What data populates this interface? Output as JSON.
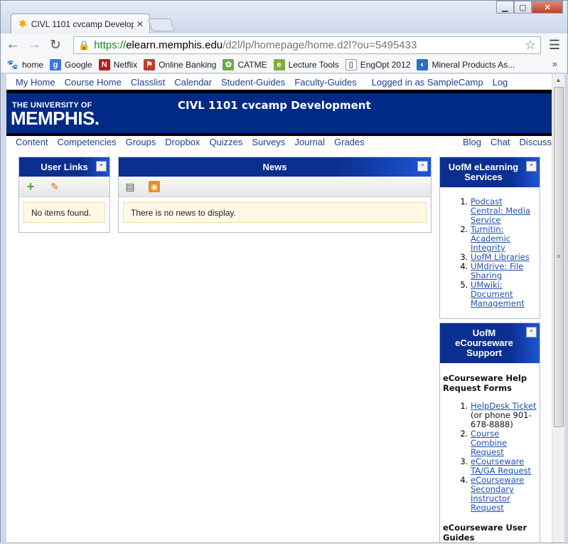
{
  "browser": {
    "tab_title": "CIVL 1101 cvcamp Develop",
    "url_scheme": "https://",
    "url_host": "elearn.memphis.edu",
    "url_path": "/d2l/lp/homepage/home.d2l?ou=5495433",
    "bookmarks": [
      {
        "label": "home",
        "icon": "paw-icon",
        "color": "#1c3f94"
      },
      {
        "label": "Google",
        "icon": "google-icon",
        "color": "#3b76d9"
      },
      {
        "label": "Netflix",
        "icon": "netflix-icon",
        "color": "#b51d1d"
      },
      {
        "label": "Online Banking",
        "icon": "bank-icon",
        "color": "#c23a2b"
      },
      {
        "label": "CATME",
        "icon": "catme-icon",
        "color": "#6aa84f"
      },
      {
        "label": "Lecture Tools",
        "icon": "lecture-tools-icon",
        "color": "#7fae3c"
      },
      {
        "label": "EngOpt 2012",
        "icon": "document-icon",
        "color": "#ffffff"
      },
      {
        "label": "Mineral Products As...",
        "icon": "mineral-icon",
        "color": "#2b6fbd"
      }
    ],
    "more_label": "»"
  },
  "topnav": {
    "items": [
      "My Home",
      "Course Home",
      "Classlist",
      "Calendar",
      "Student-Guides",
      "Faculty-Guides"
    ],
    "login": "Logged in as SampleCamp",
    "logout": "Log"
  },
  "banner": {
    "logo_top": "THE UNIVERSITY OF",
    "logo_main": "MEMPHIS.",
    "course_title": "CIVL 1101 cvcamp Development"
  },
  "coursenav": {
    "items": [
      "Content",
      "Competencies",
      "Groups",
      "Dropbox",
      "Quizzes",
      "Surveys",
      "Journal",
      "Grades"
    ],
    "right_items": [
      "Blog",
      "Chat",
      "Discuss"
    ]
  },
  "user_links": {
    "title": "User Links",
    "empty": "No items found."
  },
  "news": {
    "title": "News",
    "empty": "There is no news to display."
  },
  "elearning": {
    "title": "UofM eLearning Services",
    "links": [
      "Podcast Central: Media Service",
      "Turnitin: Academic Integrity",
      "UofM Libraries",
      "UMdrive: File Sharing",
      "UMwiki: Document Management"
    ]
  },
  "ecourseware": {
    "title": "UofM eCourseware Support",
    "heading": "eCourseware Help Request Forms",
    "links": [
      {
        "link": "HelpDesk Ticket",
        "note": "(or phone 901-678-8888)"
      },
      {
        "link": "Course Combine Request",
        "note": ""
      },
      {
        "link": "eCourseware TA/GA Request",
        "note": ""
      },
      {
        "link": "eCourseware Secondary Instructor Request",
        "note": ""
      }
    ],
    "heading2": "eCourseware User Guides"
  },
  "colors": {
    "brand_blue": "#002a86",
    "link_blue": "#1e3f8c",
    "notice_bg": "#fff8e3"
  }
}
